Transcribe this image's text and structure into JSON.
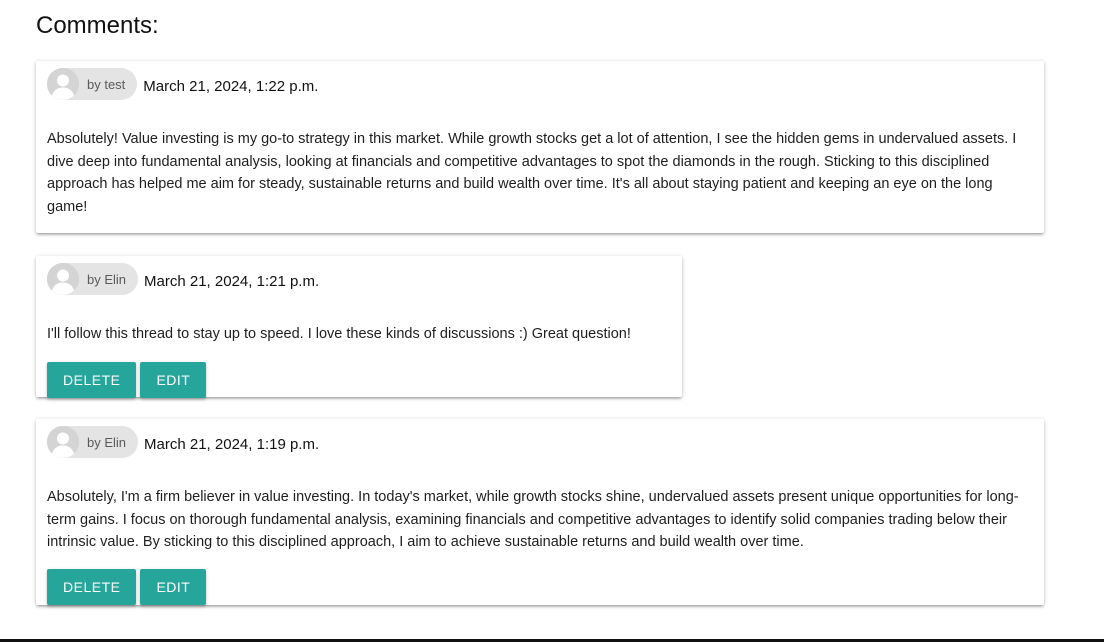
{
  "section": {
    "title": "Comments:"
  },
  "comments": [
    {
      "author": "by test",
      "date": "March 21, 2024, 1:22 p.m.",
      "body": "Absolutely! Value investing is my go-to strategy in this market. While growth stocks get a lot of attention, I see the hidden gems in undervalued assets. I dive deep into fundamental analysis, looking at financials and competitive advantages to spot the diamonds in the rough. Sticking to this disciplined approach has helped me aim for steady, sustainable returns and build wealth over time. It's all about staying patient and keeping an eye on the long game!"
    },
    {
      "author": "by Elin",
      "date": "March 21, 2024, 1:21 p.m.",
      "body": "I'll follow this thread to stay up to speed. I love these kinds of discussions :) Great question!",
      "delete_label": "DELETE",
      "edit_label": "EDIT"
    },
    {
      "author": "by Elin",
      "date": "March 21, 2024, 1:19 p.m.",
      "body": "Absolutely, I'm a firm believer in value investing. In today's market, while growth stocks shine, undervalued assets present unique opportunities for long-term gains. I focus on thorough fundamental analysis, examining financials and competitive advantages to identify solid companies trading below their intrinsic value. By sticking to this disciplined approach, I aim to achieve sustainable returns and build wealth over time.",
      "delete_label": "DELETE",
      "edit_label": "EDIT"
    }
  ],
  "colors": {
    "button": "#26a69a",
    "chip": "#e4e4e4"
  },
  "icons": {
    "avatar": "user-avatar-icon"
  }
}
